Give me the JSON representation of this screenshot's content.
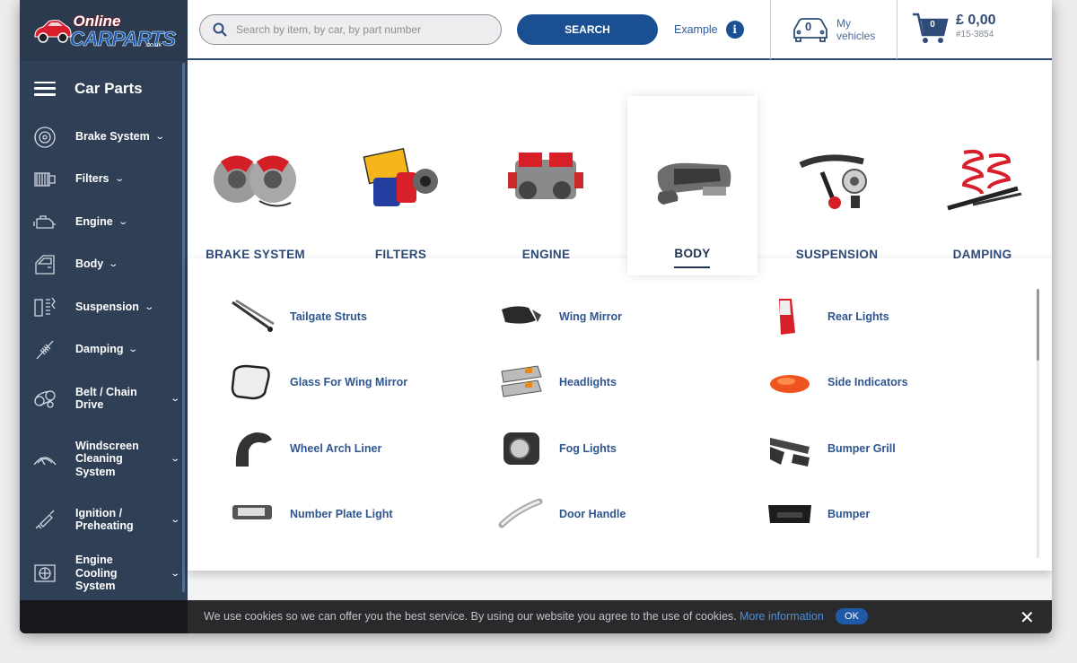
{
  "logo": {
    "line1": "Online",
    "line2": "CARPARTS",
    "line3": ".co.uk"
  },
  "header": {
    "search_placeholder": "Search by item, by car, by part number",
    "search_button": "SEARCH",
    "example_label": "Example",
    "info_glyph": "i",
    "vehicles_count": "0",
    "vehicles_line1": "My",
    "vehicles_line2": "vehicles",
    "cart_count": "0",
    "cart_price": "£ 0,00",
    "cart_id": "#15-3854"
  },
  "sidebar": {
    "title": "Car Parts",
    "items": [
      {
        "label": "Brake System",
        "icon": "brake-disc-icon"
      },
      {
        "label": "Filters",
        "icon": "filter-icon"
      },
      {
        "label": "Engine",
        "icon": "engine-icon"
      },
      {
        "label": "Body",
        "icon": "car-door-icon"
      },
      {
        "label": "Suspension",
        "icon": "suspension-icon"
      },
      {
        "label": "Damping",
        "icon": "shock-absorber-icon"
      },
      {
        "label": "Belt / Chain Drive",
        "icon": "belt-drive-icon"
      },
      {
        "label": "Windscreen Cleaning System",
        "icon": "wiper-icon"
      },
      {
        "label": "Ignition / Preheating",
        "icon": "spark-plug-icon"
      },
      {
        "label": "Engine Cooling System",
        "icon": "radiator-icon"
      }
    ]
  },
  "categories": [
    {
      "label": "BRAKE SYSTEM"
    },
    {
      "label": "FILTERS"
    },
    {
      "label": "ENGINE"
    },
    {
      "label": "BODY"
    },
    {
      "label": "SUSPENSION"
    },
    {
      "label": "DAMPING"
    }
  ],
  "subcategories": [
    {
      "label": "Tailgate Struts"
    },
    {
      "label": "Wing Mirror"
    },
    {
      "label": "Rear Lights"
    },
    {
      "label": "Glass For Wing Mirror"
    },
    {
      "label": "Headlights"
    },
    {
      "label": "Side Indicators"
    },
    {
      "label": "Wheel Arch Liner"
    },
    {
      "label": "Fog Lights"
    },
    {
      "label": "Bumper Grill"
    },
    {
      "label": "Number Plate Light"
    },
    {
      "label": "Door Handle"
    },
    {
      "label": "Bumper"
    }
  ],
  "cookie": {
    "text": "We use cookies so we can offer you the best service. By using our website you agree to the use of cookies.",
    "more": "More information",
    "ok": "OK",
    "close": "✕"
  },
  "colors": {
    "sidebar": "#2f3f55",
    "accent": "#1a4f91",
    "link": "#2f5590"
  }
}
